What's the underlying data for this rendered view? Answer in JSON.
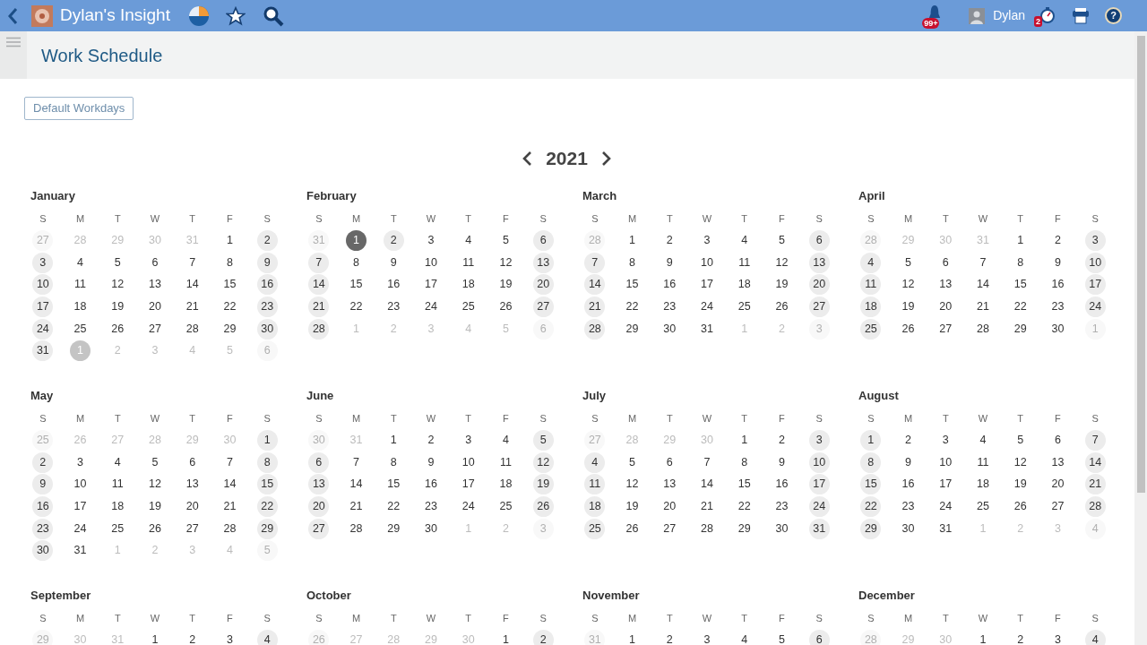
{
  "app_bar": {
    "title": "Dylan's Insight",
    "notifications_badge": "99+",
    "user_name": "Dylan",
    "timer_badge": "2",
    "help_label": "?"
  },
  "page": {
    "title": "Work Schedule",
    "default_button": "Default Workdays",
    "year": "2021"
  },
  "months": [
    {
      "name": "January",
      "weekdays": [
        "S",
        "M",
        "T",
        "W",
        "T",
        "F",
        "S"
      ],
      "weeks": [
        [
          {
            "day": "27",
            "kind": "outside"
          },
          {
            "day": "28",
            "kind": "outside"
          },
          {
            "day": "29",
            "kind": "outside"
          },
          {
            "day": "30",
            "kind": "outside"
          },
          {
            "day": "31",
            "kind": "outside"
          },
          {
            "day": "1",
            "kind": "work"
          },
          {
            "day": "2",
            "kind": "off"
          }
        ],
        [
          {
            "day": "3",
            "kind": "off"
          },
          {
            "day": "4",
            "kind": "work"
          },
          {
            "day": "5",
            "kind": "work"
          },
          {
            "day": "6",
            "kind": "work"
          },
          {
            "day": "7",
            "kind": "work"
          },
          {
            "day": "8",
            "kind": "work"
          },
          {
            "day": "9",
            "kind": "off"
          }
        ],
        [
          {
            "day": "10",
            "kind": "off"
          },
          {
            "day": "11",
            "kind": "work"
          },
          {
            "day": "12",
            "kind": "work"
          },
          {
            "day": "13",
            "kind": "work"
          },
          {
            "day": "14",
            "kind": "work"
          },
          {
            "day": "15",
            "kind": "work"
          },
          {
            "day": "16",
            "kind": "off"
          }
        ],
        [
          {
            "day": "17",
            "kind": "off"
          },
          {
            "day": "18",
            "kind": "work"
          },
          {
            "day": "19",
            "kind": "work"
          },
          {
            "day": "20",
            "kind": "work"
          },
          {
            "day": "21",
            "kind": "work"
          },
          {
            "day": "22",
            "kind": "work"
          },
          {
            "day": "23",
            "kind": "off"
          }
        ],
        [
          {
            "day": "24",
            "kind": "off"
          },
          {
            "day": "25",
            "kind": "work"
          },
          {
            "day": "26",
            "kind": "work"
          },
          {
            "day": "27",
            "kind": "work"
          },
          {
            "day": "28",
            "kind": "work"
          },
          {
            "day": "29",
            "kind": "work"
          },
          {
            "day": "30",
            "kind": "off"
          }
        ],
        [
          {
            "day": "31",
            "kind": "off"
          },
          {
            "day": "1",
            "kind": "hover"
          },
          {
            "day": "2",
            "kind": "outside"
          },
          {
            "day": "3",
            "kind": "outside"
          },
          {
            "day": "4",
            "kind": "outside"
          },
          {
            "day": "5",
            "kind": "outside"
          },
          {
            "day": "6",
            "kind": "outside"
          }
        ]
      ]
    },
    {
      "name": "February",
      "weekdays": [
        "S",
        "M",
        "T",
        "W",
        "T",
        "F",
        "S"
      ],
      "weeks": [
        [
          {
            "day": "31",
            "kind": "outside"
          },
          {
            "day": "1",
            "kind": "selected"
          },
          {
            "day": "2",
            "kind": "off"
          },
          {
            "day": "3",
            "kind": "work"
          },
          {
            "day": "4",
            "kind": "work"
          },
          {
            "day": "5",
            "kind": "work"
          },
          {
            "day": "6",
            "kind": "off"
          }
        ],
        [
          {
            "day": "7",
            "kind": "off"
          },
          {
            "day": "8",
            "kind": "work"
          },
          {
            "day": "9",
            "kind": "work"
          },
          {
            "day": "10",
            "kind": "work"
          },
          {
            "day": "11",
            "kind": "work"
          },
          {
            "day": "12",
            "kind": "work"
          },
          {
            "day": "13",
            "kind": "off"
          }
        ],
        [
          {
            "day": "14",
            "kind": "off"
          },
          {
            "day": "15",
            "kind": "work"
          },
          {
            "day": "16",
            "kind": "work"
          },
          {
            "day": "17",
            "kind": "work"
          },
          {
            "day": "18",
            "kind": "work"
          },
          {
            "day": "19",
            "kind": "work"
          },
          {
            "day": "20",
            "kind": "off"
          }
        ],
        [
          {
            "day": "21",
            "kind": "off"
          },
          {
            "day": "22",
            "kind": "work"
          },
          {
            "day": "23",
            "kind": "work"
          },
          {
            "day": "24",
            "kind": "work"
          },
          {
            "day": "25",
            "kind": "work"
          },
          {
            "day": "26",
            "kind": "work"
          },
          {
            "day": "27",
            "kind": "off"
          }
        ],
        [
          {
            "day": "28",
            "kind": "off"
          },
          {
            "day": "1",
            "kind": "outside"
          },
          {
            "day": "2",
            "kind": "outside"
          },
          {
            "day": "3",
            "kind": "outside"
          },
          {
            "day": "4",
            "kind": "outside"
          },
          {
            "day": "5",
            "kind": "outside"
          },
          {
            "day": "6",
            "kind": "outside"
          }
        ]
      ]
    },
    {
      "name": "March",
      "weekdays": [
        "S",
        "M",
        "T",
        "W",
        "T",
        "F",
        "S"
      ],
      "weeks": [
        [
          {
            "day": "28",
            "kind": "outside"
          },
          {
            "day": "1",
            "kind": "work"
          },
          {
            "day": "2",
            "kind": "work"
          },
          {
            "day": "3",
            "kind": "work"
          },
          {
            "day": "4",
            "kind": "work"
          },
          {
            "day": "5",
            "kind": "work"
          },
          {
            "day": "6",
            "kind": "off"
          }
        ],
        [
          {
            "day": "7",
            "kind": "off"
          },
          {
            "day": "8",
            "kind": "work"
          },
          {
            "day": "9",
            "kind": "work"
          },
          {
            "day": "10",
            "kind": "work"
          },
          {
            "day": "11",
            "kind": "work"
          },
          {
            "day": "12",
            "kind": "work"
          },
          {
            "day": "13",
            "kind": "off"
          }
        ],
        [
          {
            "day": "14",
            "kind": "off"
          },
          {
            "day": "15",
            "kind": "work"
          },
          {
            "day": "16",
            "kind": "work"
          },
          {
            "day": "17",
            "kind": "work"
          },
          {
            "day": "18",
            "kind": "work"
          },
          {
            "day": "19",
            "kind": "work"
          },
          {
            "day": "20",
            "kind": "off"
          }
        ],
        [
          {
            "day": "21",
            "kind": "off"
          },
          {
            "day": "22",
            "kind": "work"
          },
          {
            "day": "23",
            "kind": "work"
          },
          {
            "day": "24",
            "kind": "work"
          },
          {
            "day": "25",
            "kind": "work"
          },
          {
            "day": "26",
            "kind": "work"
          },
          {
            "day": "27",
            "kind": "off"
          }
        ],
        [
          {
            "day": "28",
            "kind": "off"
          },
          {
            "day": "29",
            "kind": "work"
          },
          {
            "day": "30",
            "kind": "work"
          },
          {
            "day": "31",
            "kind": "work"
          },
          {
            "day": "1",
            "kind": "outside"
          },
          {
            "day": "2",
            "kind": "outside"
          },
          {
            "day": "3",
            "kind": "outside"
          }
        ]
      ]
    },
    {
      "name": "April",
      "weekdays": [
        "S",
        "M",
        "T",
        "W",
        "T",
        "F",
        "S"
      ],
      "weeks": [
        [
          {
            "day": "28",
            "kind": "outside"
          },
          {
            "day": "29",
            "kind": "outside"
          },
          {
            "day": "30",
            "kind": "outside"
          },
          {
            "day": "31",
            "kind": "outside"
          },
          {
            "day": "1",
            "kind": "work"
          },
          {
            "day": "2",
            "kind": "work"
          },
          {
            "day": "3",
            "kind": "off"
          }
        ],
        [
          {
            "day": "4",
            "kind": "off"
          },
          {
            "day": "5",
            "kind": "work"
          },
          {
            "day": "6",
            "kind": "work"
          },
          {
            "day": "7",
            "kind": "work"
          },
          {
            "day": "8",
            "kind": "work"
          },
          {
            "day": "9",
            "kind": "work"
          },
          {
            "day": "10",
            "kind": "off"
          }
        ],
        [
          {
            "day": "11",
            "kind": "off"
          },
          {
            "day": "12",
            "kind": "work"
          },
          {
            "day": "13",
            "kind": "work"
          },
          {
            "day": "14",
            "kind": "work"
          },
          {
            "day": "15",
            "kind": "work"
          },
          {
            "day": "16",
            "kind": "work"
          },
          {
            "day": "17",
            "kind": "off"
          }
        ],
        [
          {
            "day": "18",
            "kind": "off"
          },
          {
            "day": "19",
            "kind": "work"
          },
          {
            "day": "20",
            "kind": "work"
          },
          {
            "day": "21",
            "kind": "work"
          },
          {
            "day": "22",
            "kind": "work"
          },
          {
            "day": "23",
            "kind": "work"
          },
          {
            "day": "24",
            "kind": "off"
          }
        ],
        [
          {
            "day": "25",
            "kind": "off"
          },
          {
            "day": "26",
            "kind": "work"
          },
          {
            "day": "27",
            "kind": "work"
          },
          {
            "day": "28",
            "kind": "work"
          },
          {
            "day": "29",
            "kind": "work"
          },
          {
            "day": "30",
            "kind": "work"
          },
          {
            "day": "1",
            "kind": "outside"
          }
        ]
      ]
    },
    {
      "name": "May",
      "weekdays": [
        "S",
        "M",
        "T",
        "W",
        "T",
        "F",
        "S"
      ],
      "weeks": [
        [
          {
            "day": "25",
            "kind": "outside"
          },
          {
            "day": "26",
            "kind": "outside"
          },
          {
            "day": "27",
            "kind": "outside"
          },
          {
            "day": "28",
            "kind": "outside"
          },
          {
            "day": "29",
            "kind": "outside"
          },
          {
            "day": "30",
            "kind": "outside"
          },
          {
            "day": "1",
            "kind": "off"
          }
        ],
        [
          {
            "day": "2",
            "kind": "off"
          },
          {
            "day": "3",
            "kind": "work"
          },
          {
            "day": "4",
            "kind": "work"
          },
          {
            "day": "5",
            "kind": "work"
          },
          {
            "day": "6",
            "kind": "work"
          },
          {
            "day": "7",
            "kind": "work"
          },
          {
            "day": "8",
            "kind": "off"
          }
        ],
        [
          {
            "day": "9",
            "kind": "off"
          },
          {
            "day": "10",
            "kind": "work"
          },
          {
            "day": "11",
            "kind": "work"
          },
          {
            "day": "12",
            "kind": "work"
          },
          {
            "day": "13",
            "kind": "work"
          },
          {
            "day": "14",
            "kind": "work"
          },
          {
            "day": "15",
            "kind": "off"
          }
        ],
        [
          {
            "day": "16",
            "kind": "off"
          },
          {
            "day": "17",
            "kind": "work"
          },
          {
            "day": "18",
            "kind": "work"
          },
          {
            "day": "19",
            "kind": "work"
          },
          {
            "day": "20",
            "kind": "work"
          },
          {
            "day": "21",
            "kind": "work"
          },
          {
            "day": "22",
            "kind": "off"
          }
        ],
        [
          {
            "day": "23",
            "kind": "off"
          },
          {
            "day": "24",
            "kind": "work"
          },
          {
            "day": "25",
            "kind": "work"
          },
          {
            "day": "26",
            "kind": "work"
          },
          {
            "day": "27",
            "kind": "work"
          },
          {
            "day": "28",
            "kind": "work"
          },
          {
            "day": "29",
            "kind": "off"
          }
        ],
        [
          {
            "day": "30",
            "kind": "off"
          },
          {
            "day": "31",
            "kind": "work"
          },
          {
            "day": "1",
            "kind": "outside"
          },
          {
            "day": "2",
            "kind": "outside"
          },
          {
            "day": "3",
            "kind": "outside"
          },
          {
            "day": "4",
            "kind": "outside"
          },
          {
            "day": "5",
            "kind": "outside"
          }
        ]
      ]
    },
    {
      "name": "June",
      "weekdays": [
        "S",
        "M",
        "T",
        "W",
        "T",
        "F",
        "S"
      ],
      "weeks": [
        [
          {
            "day": "30",
            "kind": "outside"
          },
          {
            "day": "31",
            "kind": "outside"
          },
          {
            "day": "1",
            "kind": "work"
          },
          {
            "day": "2",
            "kind": "work"
          },
          {
            "day": "3",
            "kind": "work"
          },
          {
            "day": "4",
            "kind": "work"
          },
          {
            "day": "5",
            "kind": "off"
          }
        ],
        [
          {
            "day": "6",
            "kind": "off"
          },
          {
            "day": "7",
            "kind": "work"
          },
          {
            "day": "8",
            "kind": "work"
          },
          {
            "day": "9",
            "kind": "work"
          },
          {
            "day": "10",
            "kind": "work"
          },
          {
            "day": "11",
            "kind": "work"
          },
          {
            "day": "12",
            "kind": "off"
          }
        ],
        [
          {
            "day": "13",
            "kind": "off"
          },
          {
            "day": "14",
            "kind": "work"
          },
          {
            "day": "15",
            "kind": "work"
          },
          {
            "day": "16",
            "kind": "work"
          },
          {
            "day": "17",
            "kind": "work"
          },
          {
            "day": "18",
            "kind": "work"
          },
          {
            "day": "19",
            "kind": "off"
          }
        ],
        [
          {
            "day": "20",
            "kind": "off"
          },
          {
            "day": "21",
            "kind": "work"
          },
          {
            "day": "22",
            "kind": "work"
          },
          {
            "day": "23",
            "kind": "work"
          },
          {
            "day": "24",
            "kind": "work"
          },
          {
            "day": "25",
            "kind": "work"
          },
          {
            "day": "26",
            "kind": "off"
          }
        ],
        [
          {
            "day": "27",
            "kind": "off"
          },
          {
            "day": "28",
            "kind": "work"
          },
          {
            "day": "29",
            "kind": "work"
          },
          {
            "day": "30",
            "kind": "work"
          },
          {
            "day": "1",
            "kind": "outside"
          },
          {
            "day": "2",
            "kind": "outside"
          },
          {
            "day": "3",
            "kind": "outside"
          }
        ]
      ]
    },
    {
      "name": "July",
      "weekdays": [
        "S",
        "M",
        "T",
        "W",
        "T",
        "F",
        "S"
      ],
      "weeks": [
        [
          {
            "day": "27",
            "kind": "outside"
          },
          {
            "day": "28",
            "kind": "outside"
          },
          {
            "day": "29",
            "kind": "outside"
          },
          {
            "day": "30",
            "kind": "outside"
          },
          {
            "day": "1",
            "kind": "work"
          },
          {
            "day": "2",
            "kind": "work"
          },
          {
            "day": "3",
            "kind": "off"
          }
        ],
        [
          {
            "day": "4",
            "kind": "off"
          },
          {
            "day": "5",
            "kind": "work"
          },
          {
            "day": "6",
            "kind": "work"
          },
          {
            "day": "7",
            "kind": "work"
          },
          {
            "day": "8",
            "kind": "work"
          },
          {
            "day": "9",
            "kind": "work"
          },
          {
            "day": "10",
            "kind": "off"
          }
        ],
        [
          {
            "day": "11",
            "kind": "off"
          },
          {
            "day": "12",
            "kind": "work"
          },
          {
            "day": "13",
            "kind": "work"
          },
          {
            "day": "14",
            "kind": "work"
          },
          {
            "day": "15",
            "kind": "work"
          },
          {
            "day": "16",
            "kind": "work"
          },
          {
            "day": "17",
            "kind": "off"
          }
        ],
        [
          {
            "day": "18",
            "kind": "off"
          },
          {
            "day": "19",
            "kind": "work"
          },
          {
            "day": "20",
            "kind": "work"
          },
          {
            "day": "21",
            "kind": "work"
          },
          {
            "day": "22",
            "kind": "work"
          },
          {
            "day": "23",
            "kind": "work"
          },
          {
            "day": "24",
            "kind": "off"
          }
        ],
        [
          {
            "day": "25",
            "kind": "off"
          },
          {
            "day": "26",
            "kind": "work"
          },
          {
            "day": "27",
            "kind": "work"
          },
          {
            "day": "28",
            "kind": "work"
          },
          {
            "day": "29",
            "kind": "work"
          },
          {
            "day": "30",
            "kind": "work"
          },
          {
            "day": "31",
            "kind": "off"
          }
        ]
      ]
    },
    {
      "name": "August",
      "weekdays": [
        "S",
        "M",
        "T",
        "W",
        "T",
        "F",
        "S"
      ],
      "weeks": [
        [
          {
            "day": "1",
            "kind": "off"
          },
          {
            "day": "2",
            "kind": "work"
          },
          {
            "day": "3",
            "kind": "work"
          },
          {
            "day": "4",
            "kind": "work"
          },
          {
            "day": "5",
            "kind": "work"
          },
          {
            "day": "6",
            "kind": "work"
          },
          {
            "day": "7",
            "kind": "off"
          }
        ],
        [
          {
            "day": "8",
            "kind": "off"
          },
          {
            "day": "9",
            "kind": "work"
          },
          {
            "day": "10",
            "kind": "work"
          },
          {
            "day": "11",
            "kind": "work"
          },
          {
            "day": "12",
            "kind": "work"
          },
          {
            "day": "13",
            "kind": "work"
          },
          {
            "day": "14",
            "kind": "off"
          }
        ],
        [
          {
            "day": "15",
            "kind": "off"
          },
          {
            "day": "16",
            "kind": "work"
          },
          {
            "day": "17",
            "kind": "work"
          },
          {
            "day": "18",
            "kind": "work"
          },
          {
            "day": "19",
            "kind": "work"
          },
          {
            "day": "20",
            "kind": "work"
          },
          {
            "day": "21",
            "kind": "off"
          }
        ],
        [
          {
            "day": "22",
            "kind": "off"
          },
          {
            "day": "23",
            "kind": "work"
          },
          {
            "day": "24",
            "kind": "work"
          },
          {
            "day": "25",
            "kind": "work"
          },
          {
            "day": "26",
            "kind": "work"
          },
          {
            "day": "27",
            "kind": "work"
          },
          {
            "day": "28",
            "kind": "off"
          }
        ],
        [
          {
            "day": "29",
            "kind": "off"
          },
          {
            "day": "30",
            "kind": "work"
          },
          {
            "day": "31",
            "kind": "work"
          },
          {
            "day": "1",
            "kind": "outside"
          },
          {
            "day": "2",
            "kind": "outside"
          },
          {
            "day": "3",
            "kind": "outside"
          },
          {
            "day": "4",
            "kind": "outside"
          }
        ]
      ]
    },
    {
      "name": "September",
      "weekdays": [
        "S",
        "M",
        "T",
        "W",
        "T",
        "F",
        "S"
      ],
      "weeks": [
        [
          {
            "day": "29",
            "kind": "outside"
          },
          {
            "day": "30",
            "kind": "outside"
          },
          {
            "day": "31",
            "kind": "outside"
          },
          {
            "day": "1",
            "kind": "work"
          },
          {
            "day": "2",
            "kind": "work"
          },
          {
            "day": "3",
            "kind": "work"
          },
          {
            "day": "4",
            "kind": "off"
          }
        ]
      ]
    },
    {
      "name": "October",
      "weekdays": [
        "S",
        "M",
        "T",
        "W",
        "T",
        "F",
        "S"
      ],
      "weeks": [
        [
          {
            "day": "26",
            "kind": "outside"
          },
          {
            "day": "27",
            "kind": "outside"
          },
          {
            "day": "28",
            "kind": "outside"
          },
          {
            "day": "29",
            "kind": "outside"
          },
          {
            "day": "30",
            "kind": "outside"
          },
          {
            "day": "1",
            "kind": "work"
          },
          {
            "day": "2",
            "kind": "off"
          }
        ]
      ]
    },
    {
      "name": "November",
      "weekdays": [
        "S",
        "M",
        "T",
        "W",
        "T",
        "F",
        "S"
      ],
      "weeks": [
        [
          {
            "day": "31",
            "kind": "outside"
          },
          {
            "day": "1",
            "kind": "work"
          },
          {
            "day": "2",
            "kind": "work"
          },
          {
            "day": "3",
            "kind": "work"
          },
          {
            "day": "4",
            "kind": "work"
          },
          {
            "day": "5",
            "kind": "work"
          },
          {
            "day": "6",
            "kind": "off"
          }
        ]
      ]
    },
    {
      "name": "December",
      "weekdays": [
        "S",
        "M",
        "T",
        "W",
        "T",
        "F",
        "S"
      ],
      "weeks": [
        [
          {
            "day": "28",
            "kind": "outside"
          },
          {
            "day": "29",
            "kind": "outside"
          },
          {
            "day": "30",
            "kind": "outside"
          },
          {
            "day": "1",
            "kind": "work"
          },
          {
            "day": "2",
            "kind": "work"
          },
          {
            "day": "3",
            "kind": "work"
          },
          {
            "day": "4",
            "kind": "off"
          }
        ]
      ]
    }
  ]
}
